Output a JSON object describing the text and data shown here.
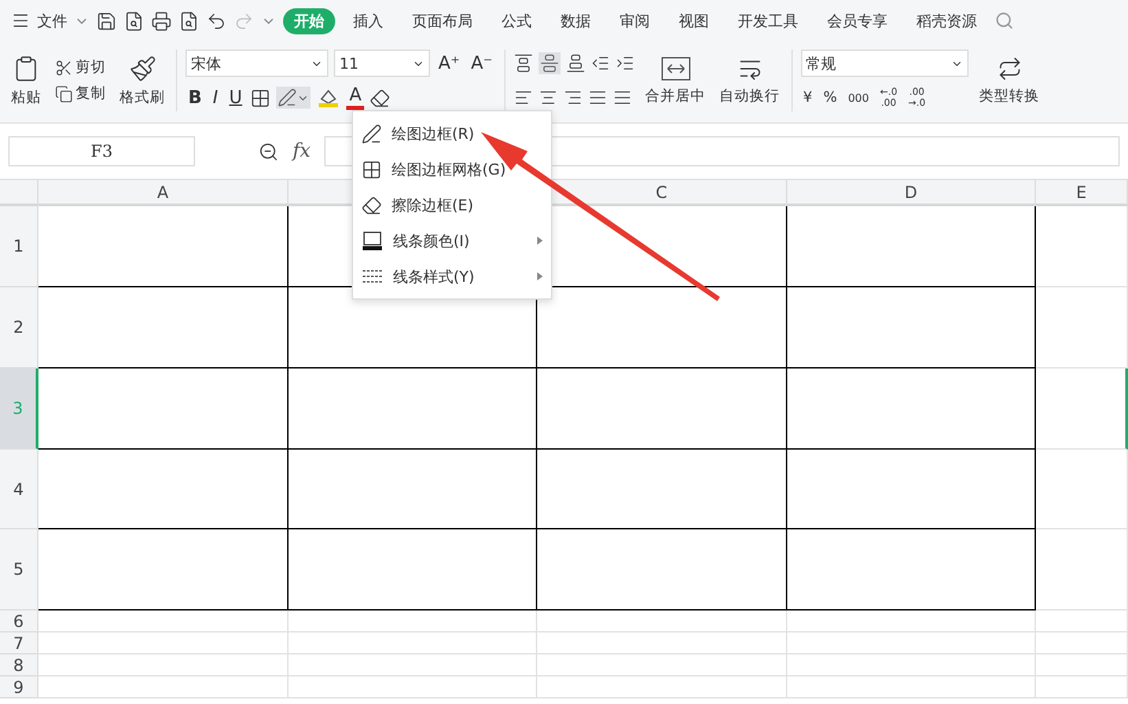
{
  "menu_bar": {
    "file_menu": "文件",
    "tabs": [
      {
        "label": "开始",
        "selected": true
      },
      {
        "label": "插入",
        "selected": false
      },
      {
        "label": "页面布局",
        "selected": false
      },
      {
        "label": "公式",
        "selected": false
      },
      {
        "label": "数据",
        "selected": false
      },
      {
        "label": "审阅",
        "selected": false
      },
      {
        "label": "视图",
        "selected": false
      },
      {
        "label": "开发工具",
        "selected": false
      },
      {
        "label": "会员专享",
        "selected": false
      },
      {
        "label": "稻壳资源",
        "selected": false
      }
    ]
  },
  "ribbon": {
    "paste": "粘贴",
    "cut": "剪切",
    "copy": "复制",
    "format_painter": "格式刷",
    "font_name": "宋体",
    "font_size": "11",
    "grow_font": "A⁺",
    "shrink_font": "A⁻",
    "bold": "B",
    "italic": "I",
    "underline": "U",
    "font_color": "A",
    "merge_center": "合并居中",
    "wrap_text": "自动换行",
    "number_format": "常规",
    "currency": "¥",
    "percent": "%",
    "thousands": "000",
    "add_decimal": {
      "top": "←.0",
      "bottom": ".00"
    },
    "remove_decimal": {
      "top": ".00",
      "bottom": "→.0"
    },
    "type_convert": "类型转换"
  },
  "formula_bar": {
    "name_box": "F3",
    "fx": "fx"
  },
  "sheet": {
    "columns": [
      {
        "label": "A"
      },
      {},
      {
        "label": "C"
      },
      {
        "label": "D"
      },
      {
        "label": "E"
      }
    ],
    "rows": [
      {
        "label": "1",
        "selected": false
      },
      {
        "label": "2",
        "selected": false
      },
      {
        "label": "3",
        "selected": true
      },
      {
        "label": "4",
        "selected": false
      },
      {
        "label": "5",
        "selected": false
      },
      {
        "label": "6",
        "selected": false
      },
      {
        "label": "7",
        "selected": false
      },
      {
        "label": "8",
        "selected": false
      },
      {
        "label": "9",
        "selected": false
      }
    ]
  },
  "border_menu": {
    "items": [
      {
        "label": "绘图边框(R)",
        "kind": "draw",
        "submenu": false
      },
      {
        "label": "绘图边框网格(G)",
        "kind": "grid",
        "submenu": false
      },
      {
        "label": "擦除边框(E)",
        "kind": "erase",
        "submenu": false
      },
      {
        "label": "线条颜色(I)",
        "kind": "color",
        "submenu": true
      },
      {
        "label": "线条样式(Y)",
        "kind": "style",
        "submenu": true
      }
    ]
  }
}
